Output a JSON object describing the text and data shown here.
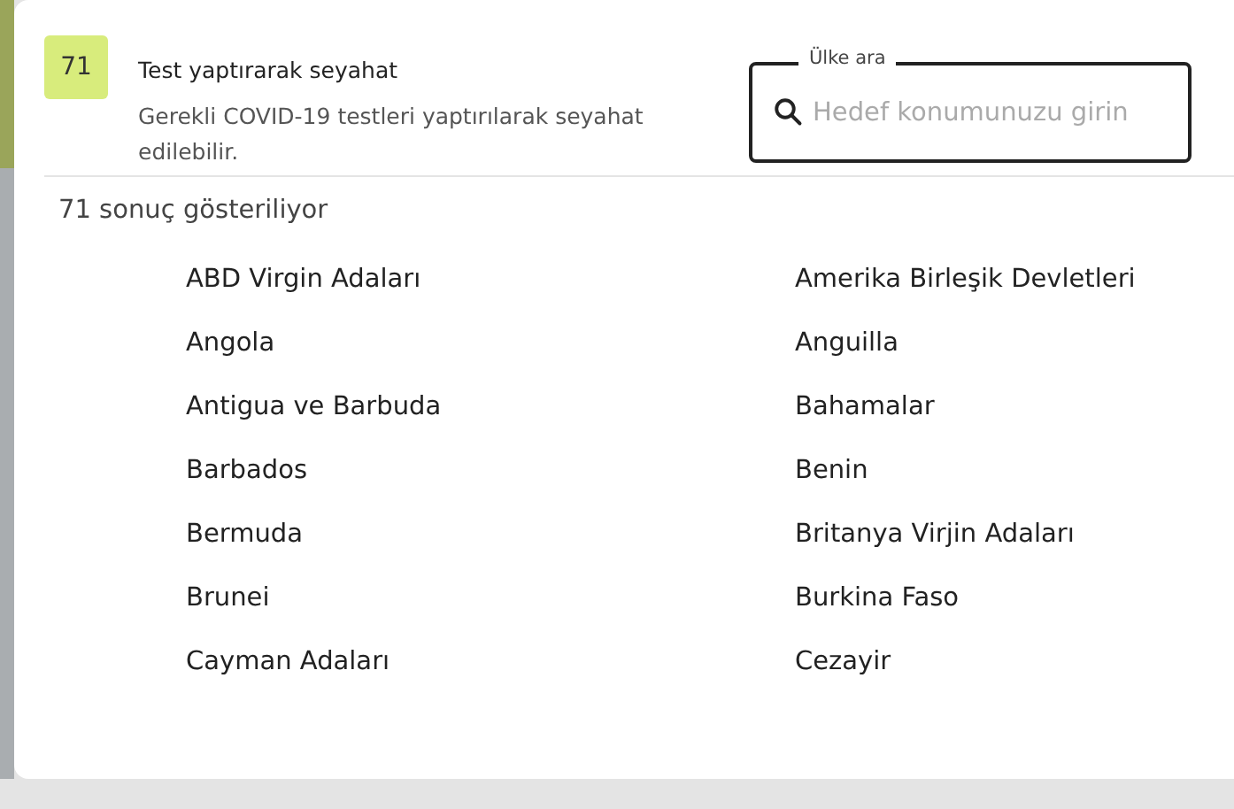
{
  "header": {
    "badge": "71",
    "title": "Test yaptırarak seyahat",
    "description": "Gerekli COVID-19 testleri yaptırılarak seyahat edilebilir."
  },
  "search": {
    "label": "Ülke ara",
    "placeholder": "Hedef konumunuzu girin"
  },
  "result_count": "71 sonuç gösteriliyor",
  "countries": [
    "ABD Virgin Adaları",
    "Amerika Birleşik Devletleri",
    "Angola",
    "Anguilla",
    "Antigua ve Barbuda",
    "Bahamalar",
    "Barbados",
    "Benin",
    "Bermuda",
    "Britanya Virjin Adaları",
    "Brunei",
    "Burkina Faso",
    "Cayman Adaları",
    "Cezayir"
  ]
}
